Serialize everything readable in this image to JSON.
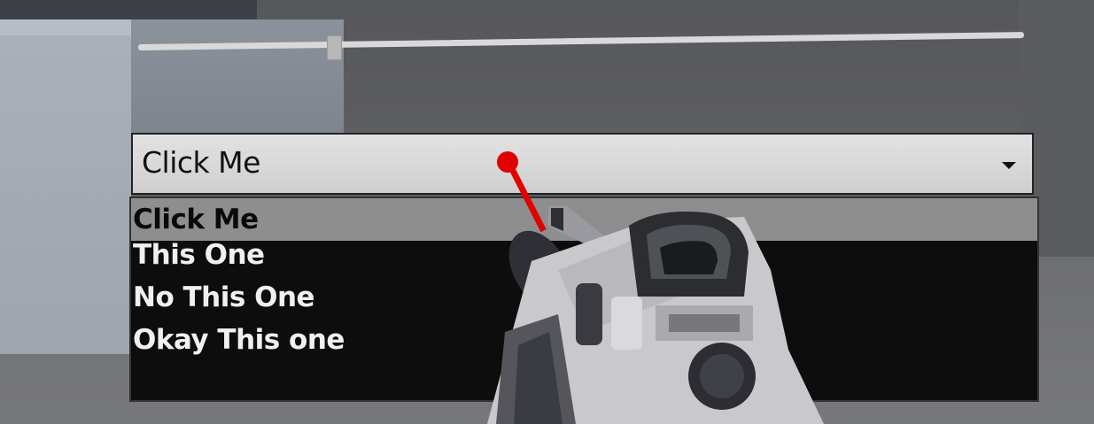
{
  "slider": {
    "value": 0.22
  },
  "combobox": {
    "selected_label": "Click Me",
    "options": [
      {
        "label": "Click Me",
        "selected": true
      },
      {
        "label": "This One",
        "selected": false
      },
      {
        "label": "No This One",
        "selected": false
      },
      {
        "label": "Okay This one",
        "selected": false
      }
    ]
  },
  "colors": {
    "laser": "#e00000",
    "dropdown_bg": "#0d0d0d",
    "option_highlight": "#8e8e8e"
  },
  "icons": {
    "combo_arrow": "chevron-down-icon",
    "pointer": "laser-pointer-icon",
    "weapon": "vr-blaster-icon"
  }
}
